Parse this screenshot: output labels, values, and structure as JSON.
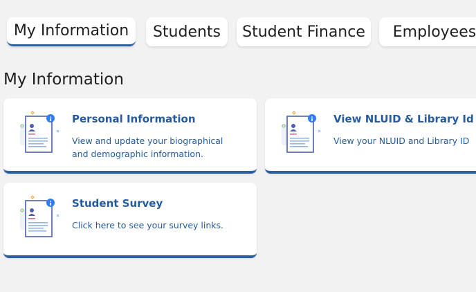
{
  "tabs": [
    {
      "label": "My Information",
      "active": true
    },
    {
      "label": "Students"
    },
    {
      "label": "Student Finance"
    },
    {
      "label": "Employees"
    }
  ],
  "section": {
    "title": "My Information"
  },
  "cards": [
    {
      "title": "Personal Information",
      "description": "View and update your biographical and demographic information.",
      "icon": "profile-document-icon"
    },
    {
      "title": "View NLUID & Library Id",
      "description": "View your NLUID and Library ID",
      "icon": "profile-document-icon"
    },
    {
      "title": "Student Survey",
      "description": "Click here to see your survey links.",
      "icon": "profile-document-icon"
    }
  ],
  "colors": {
    "accent": "#2a5fa6",
    "link": "#245b9e",
    "background": "#f2f2f2",
    "info_badge": "#2f7df6"
  }
}
